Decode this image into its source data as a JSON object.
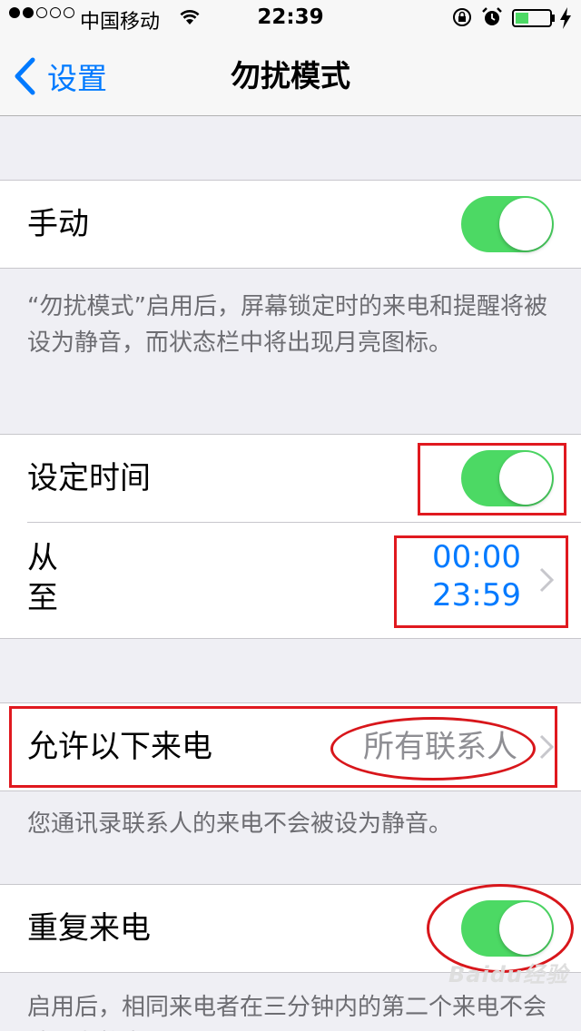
{
  "status_bar": {
    "signal_filled": 2,
    "signal_total": 5,
    "carrier": "中国移动",
    "time": "22:39"
  },
  "nav": {
    "back_label": "设置",
    "title": "勿扰模式"
  },
  "manual": {
    "label": "手动",
    "on": true,
    "footnote": "“勿扰模式”启用后，屏幕锁定时的来电和提醒将被设为静音，而状态栏中将出现月亮图标。"
  },
  "scheduled": {
    "label": "设定时间",
    "on": true,
    "from_label": "从",
    "to_label": "至",
    "from_time": "00:00",
    "to_time": "23:59"
  },
  "allow_calls": {
    "label": "允许以下来电",
    "value": "所有联系人",
    "footnote": "您通讯录联系人的来电不会被设为静音。"
  },
  "repeated_calls": {
    "label": "重复来电",
    "on": true,
    "footnote": "启用后，相同来电者在三分钟内的第二个来电不会被设为静音。"
  },
  "watermark": "Baidu经验",
  "colors": {
    "accent": "#007aff",
    "toggle_on": "#4cd964",
    "annotation": "#e0191f"
  }
}
